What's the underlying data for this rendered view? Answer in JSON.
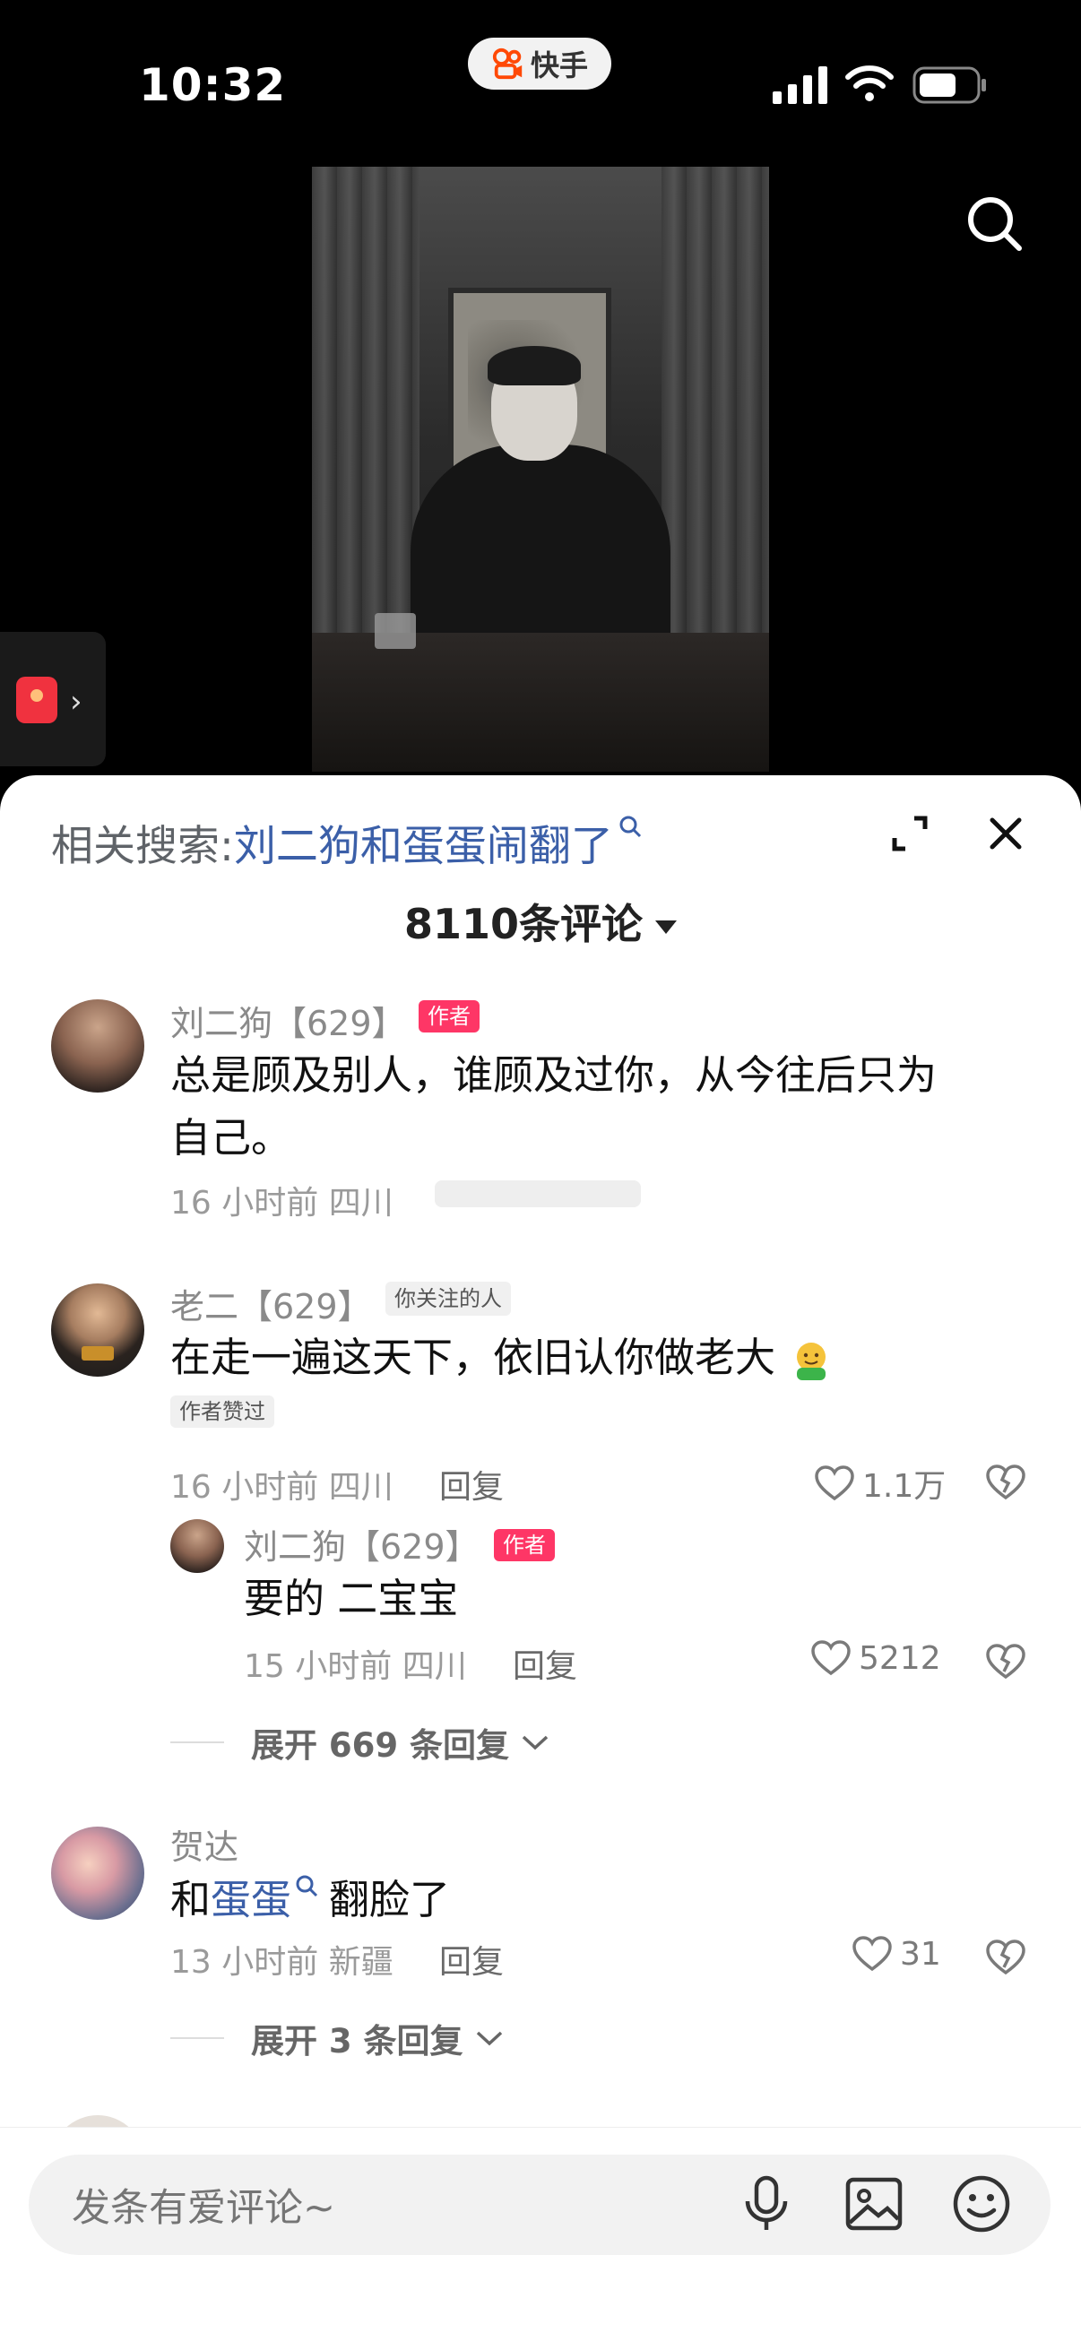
{
  "status_bar": {
    "time": "10:32",
    "app_name": "快手",
    "icons": [
      "cellular-signal-icon",
      "wifi-icon",
      "battery-icon"
    ]
  },
  "video": {
    "search_icon": "search-icon",
    "red_envelope_icon": "red-envelope-icon"
  },
  "comments_panel": {
    "related_search_label": "相关搜索:",
    "related_search_keyword": "刘二狗和蛋蛋闹翻了",
    "comment_count": "8110条评论",
    "comments": [
      {
        "username": "刘二狗【629】",
        "badge": "作者",
        "text_line1": "总是顾及别人，谁顾及过你，从今往后只为",
        "text_line2": "自己。",
        "meta": "16 小时前 四川"
      },
      {
        "username": "老二【629】",
        "badge": "你关注的人",
        "text": "在走一遍这天下，依旧认你做老大",
        "emoji": "hugging-face-emoji",
        "liked_badge": "作者赞过",
        "meta": "16 小时前 四川",
        "reply_label": "回复",
        "likes": "1.1万",
        "replies": [
          {
            "username": "刘二狗【629】",
            "badge": "作者",
            "text": "要的 二宝宝",
            "meta": "15 小时前 四川",
            "reply_label": "回复",
            "likes": "5212"
          }
        ],
        "expand_label": "展开 669 条回复"
      },
      {
        "username": "贺达",
        "text_prefix": "和",
        "text_keyword": "蛋蛋",
        "text_suffix": "翻脸了",
        "meta": "13 小时前 新疆",
        "reply_label": "回复",
        "likes": "31",
        "expand_label": "展开 3 条回复"
      }
    ]
  },
  "input_bar": {
    "placeholder": "发条有爱评论~",
    "icons": [
      "microphone-icon",
      "image-icon",
      "emoji-icon"
    ]
  },
  "colors": {
    "accent_pink": "#fe3666",
    "keyword_blue": "#3b5fa8",
    "sheet_bg": "#ffffff",
    "page_bg": "#000000"
  }
}
